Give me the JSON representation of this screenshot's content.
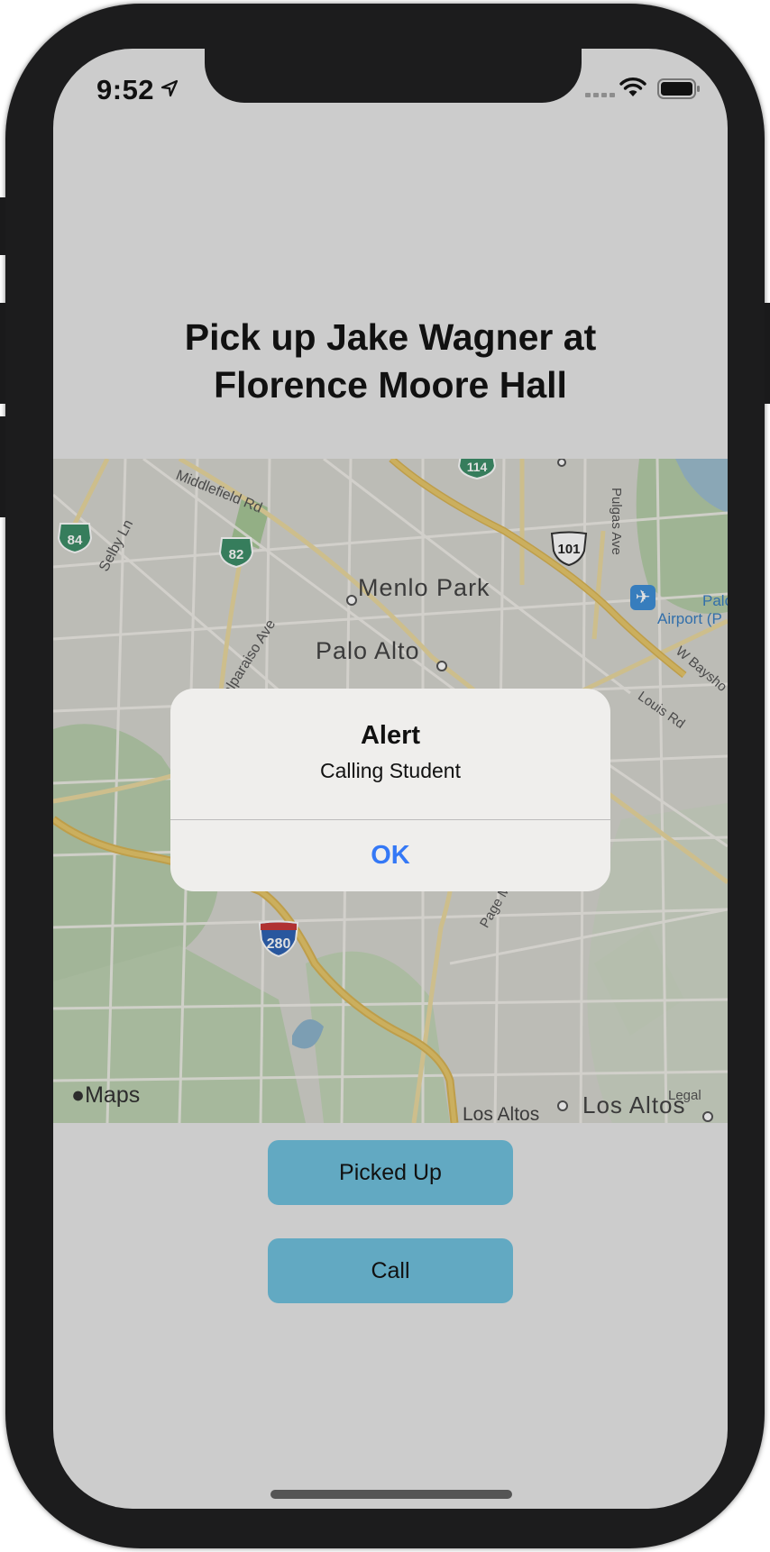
{
  "status_bar": {
    "time": "9:52"
  },
  "header": {
    "title_line1": "Pick up Jake Wagner at",
    "title_line2": "Florence Moore Hall"
  },
  "map": {
    "attribution": "Maps",
    "legal": "Legal",
    "labels": {
      "menlo_park": "Menlo Park",
      "palo_alto": "Palo Alto",
      "los_altos": "Los Altos",
      "los_altos_small": "Los Altos",
      "middlefield": "Middlefield Rd",
      "selby": "Selby Ln",
      "valparaiso": "Valparaiso Ave",
      "pulgas": "Pulgas Ave",
      "airport_1": "Palo Alt",
      "airport_2": "Airport (P",
      "bayshore": "W Baysho",
      "louis": "Louis Rd",
      "page_mill": "Page M"
    },
    "shields": {
      "sr84": "84",
      "sr82": "82",
      "sr114": "114",
      "us101": "101",
      "i280": "280"
    }
  },
  "alert": {
    "title": "Alert",
    "message": "Calling Student",
    "ok_label": "OK"
  },
  "buttons": {
    "picked_up": "Picked Up",
    "call": "Call"
  }
}
